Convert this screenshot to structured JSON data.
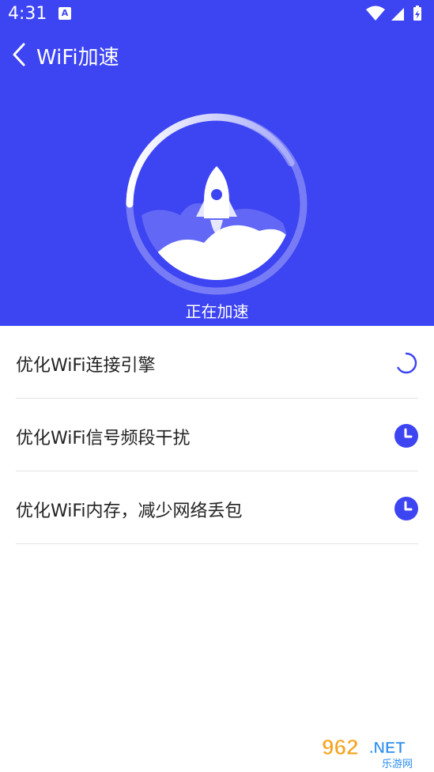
{
  "status_bar": {
    "time": "4:31",
    "notification_glyph": "A"
  },
  "header": {
    "title": "WiFi加速",
    "back_icon": "chevron-left-icon"
  },
  "hero": {
    "status_text": "正在加速",
    "illustration": "rocket-over-clouds"
  },
  "tasks": [
    {
      "label": "优化WiFi连接引擎",
      "state_icon": "loading-spinner-icon"
    },
    {
      "label": "优化WiFi信号频段干扰",
      "state_icon": "clock-icon"
    },
    {
      "label": "优化WiFi内存，减少网络丢包",
      "state_icon": "clock-icon"
    }
  ],
  "watermark": {
    "brand": "962",
    "suffix": ".NET",
    "subtitle": "乐游网"
  },
  "colors": {
    "primary": "#3d44f2",
    "text": "#222222",
    "divider": "#e3e3e3"
  }
}
